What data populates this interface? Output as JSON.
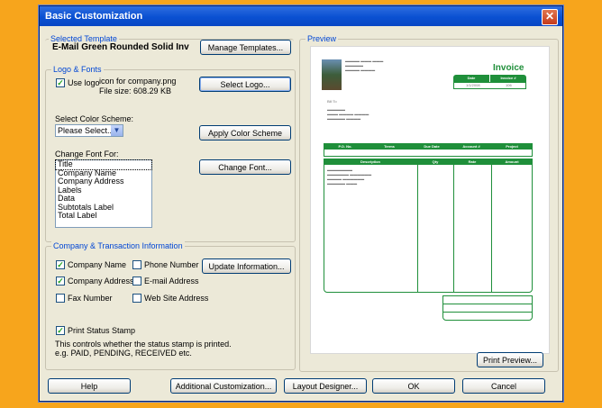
{
  "window": {
    "title": "Basic Customization"
  },
  "selected_template": {
    "group_title": "Selected Template",
    "name": "E-Mail Green Rounded Solid Inv",
    "manage_button": "Manage Templates..."
  },
  "logo_fonts": {
    "group_title": "Logo & Fonts",
    "use_logo_label": "Use logo",
    "use_logo_checked": true,
    "logo_file": "icon for company.png",
    "file_size": "File size: 608.29 KB",
    "select_logo_button": "Select Logo...",
    "color_scheme_label": "Select Color Scheme:",
    "color_scheme_value": "Please Select...",
    "apply_color_button": "Apply Color Scheme",
    "change_font_label": "Change Font For:",
    "font_items": [
      "Title",
      "Company Name",
      "Company Address",
      "Labels",
      "Data",
      "Subtotals Label",
      "Total Label"
    ],
    "change_font_button": "Change Font..."
  },
  "company_info": {
    "group_title": "Company & Transaction Information",
    "company_name": {
      "label": "Company Name",
      "checked": true
    },
    "phone_number": {
      "label": "Phone Number",
      "checked": false
    },
    "company_address": {
      "label": "Company Address",
      "checked": true
    },
    "email_address": {
      "label": "E-mail Address",
      "checked": false
    },
    "fax_number": {
      "label": "Fax Number",
      "checked": false
    },
    "web_site": {
      "label": "Web Site Address",
      "checked": false
    },
    "update_button": "Update Information...",
    "print_status_label": "Print Status Stamp",
    "print_status_checked": true,
    "status_note_1": "This controls whether the status stamp is printed.",
    "status_note_2": "e.g. PAID, PENDING, RECEIVED etc."
  },
  "preview": {
    "group_title": "Preview",
    "invoice_title": "Invoice",
    "header_cells": [
      "Date",
      "Invoice #"
    ],
    "header_values": [
      "1/1/2008",
      "106"
    ],
    "bill_to": "Bill To",
    "mid_headers": [
      "P.O. No.",
      "Terms",
      "Due Date",
      "Account #",
      "Project"
    ],
    "line_headers": [
      "Description",
      "Qty",
      "Rate",
      "Amount"
    ],
    "print_preview_button": "Print Preview..."
  },
  "footer": {
    "help": "Help",
    "additional": "Additional Customization...",
    "layout_designer": "Layout Designer...",
    "ok": "OK",
    "cancel": "Cancel"
  },
  "colors": {
    "accent_green": "#1f8f3a",
    "title_blue": "#0a50d2",
    "group_title_blue": "#0046d5"
  }
}
